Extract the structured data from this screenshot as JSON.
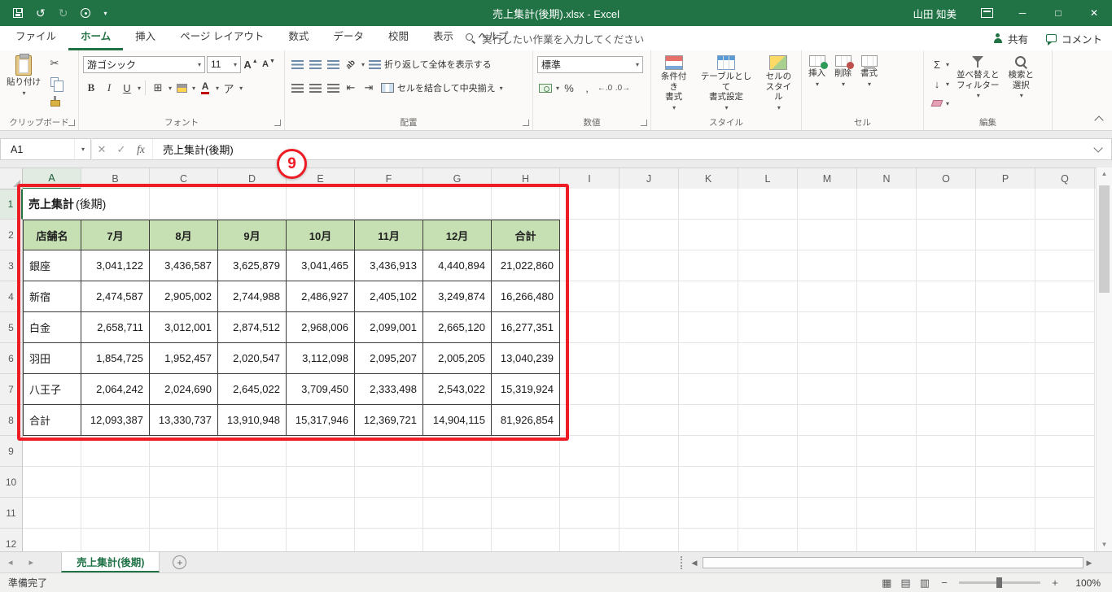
{
  "titlebar": {
    "title": "売上集計(後期).xlsx  -  Excel",
    "user": "山田 知美"
  },
  "ribbon": {
    "tabs": [
      {
        "id": "file",
        "label": "ファイル",
        "active": false
      },
      {
        "id": "home",
        "label": "ホーム",
        "active": true
      },
      {
        "id": "insert",
        "label": "挿入",
        "active": false
      },
      {
        "id": "page-layout",
        "label": "ページ レイアウト",
        "active": false
      },
      {
        "id": "formulas",
        "label": "数式",
        "active": false
      },
      {
        "id": "data",
        "label": "データ",
        "active": false
      },
      {
        "id": "review",
        "label": "校閲",
        "active": false
      },
      {
        "id": "view",
        "label": "表示",
        "active": false
      },
      {
        "id": "help",
        "label": "ヘルプ",
        "active": false
      }
    ],
    "search_placeholder": "実行したい作業を入力してください",
    "share_label": "共有",
    "comment_label": "コメント",
    "groups": [
      "クリップボード",
      "フォント",
      "配置",
      "数値",
      "スタイル",
      "セル",
      "編集"
    ],
    "clipboard": {
      "paste": "貼り付け"
    },
    "font": {
      "name": "游ゴシック",
      "size": "11"
    },
    "alignment": {
      "wrap": "折り返して全体を表示する",
      "merge": "セルを結合して中央揃え"
    },
    "number": {
      "format": "標準"
    },
    "styles": {
      "conditional": "条件付き\n書式",
      "table": "テーブルとして\n書式設定",
      "cell": "セルの\nスタイル"
    },
    "cells": {
      "insert": "挿入",
      "delete": "削除",
      "format": "書式"
    },
    "editing": {
      "sort": "並べ替えと\nフィルター",
      "find": "検索と\n選択"
    }
  },
  "formula_bar": {
    "name_box": "A1",
    "formula": "売上集計(後期)"
  },
  "annotation": {
    "number": "9"
  },
  "sheet": {
    "columns": [
      "A",
      "B",
      "C",
      "D",
      "E",
      "F",
      "G",
      "H",
      "I",
      "J",
      "K",
      "L",
      "M",
      "N",
      "O",
      "P",
      "Q"
    ],
    "row_numbers": [
      "1",
      "2",
      "3",
      "4",
      "5",
      "6",
      "7",
      "8",
      "9",
      "10",
      "11",
      "12"
    ],
    "title_cell_bold": "売上集計",
    "title_cell_rest": "(後期)",
    "header": [
      "店舗名",
      "7月",
      "8月",
      "9月",
      "10月",
      "11月",
      "12月",
      "合計"
    ],
    "data": [
      [
        "銀座",
        "3,041,122",
        "3,436,587",
        "3,625,879",
        "3,041,465",
        "3,436,913",
        "4,440,894",
        "21,022,860"
      ],
      [
        "新宿",
        "2,474,587",
        "2,905,002",
        "2,744,988",
        "2,486,927",
        "2,405,102",
        "3,249,874",
        "16,266,480"
      ],
      [
        "白金",
        "2,658,711",
        "3,012,001",
        "2,874,512",
        "2,968,006",
        "2,099,001",
        "2,665,120",
        "16,277,351"
      ],
      [
        "羽田",
        "1,854,725",
        "1,952,457",
        "2,020,547",
        "3,112,098",
        "2,095,207",
        "2,005,205",
        "13,040,239"
      ],
      [
        "八王子",
        "2,064,242",
        "2,024,690",
        "2,645,022",
        "3,709,450",
        "2,333,498",
        "2,543,022",
        "15,319,924"
      ],
      [
        "合計",
        "12,093,387",
        "13,330,737",
        "13,910,948",
        "15,317,946",
        "12,369,721",
        "14,904,115",
        "81,926,854"
      ]
    ]
  },
  "sheet_tabs": {
    "active": "売上集計(後期)"
  },
  "status_bar": {
    "mode": "準備完了",
    "zoom": "100%"
  },
  "icons": {
    "dropdown": "▾",
    "undo": "↺",
    "redo": "↻",
    "cut": "✂",
    "letter_a": "A",
    "bold": "B",
    "italic": "I",
    "underline": "U",
    "borders": "⊞",
    "phonetic": "ア",
    "orientation": "ab",
    "outdent": "⇤",
    "indent": "⇥",
    "percent": "%",
    "comma": ",",
    "inc_decimal": "←.0",
    "dec_decimal": ".0→",
    "sigma": "Σ",
    "fill_down": "↓",
    "cancel": "✕",
    "enter": "✓",
    "fx": "fx",
    "nav_left": "◂",
    "nav_right": "▸",
    "left": "◀",
    "right": "▶",
    "up": "▲",
    "down": "▼",
    "plus": "+",
    "minimize": "─",
    "maximize": "□",
    "close": "✕",
    "view_normal": "▦",
    "view_layout": "▤",
    "view_break": "▥",
    "zoom_out": "−",
    "zoom_in": "+"
  }
}
